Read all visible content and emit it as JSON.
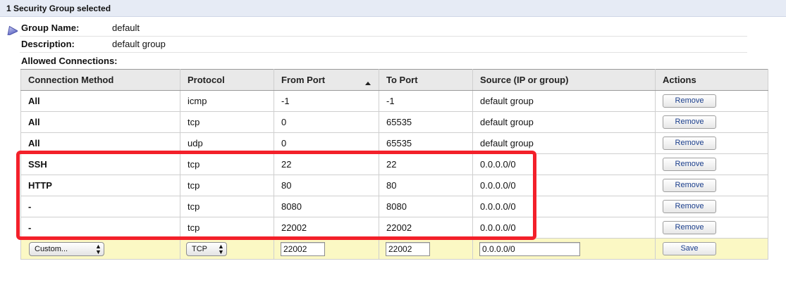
{
  "header": {
    "title": "1 Security Group selected"
  },
  "group": {
    "name_label": "Group Name:",
    "name_value": "default",
    "description_label": "Description:",
    "description_value": "default group"
  },
  "allowed": {
    "label": "Allowed Connections:",
    "columns": [
      "Connection Method",
      "Protocol",
      "From Port",
      "To Port",
      "Source (IP or group)",
      "Actions"
    ],
    "sorted_column": "From Port",
    "sort_direction": "ascending",
    "rows": [
      {
        "method": "All",
        "protocol": "icmp",
        "from": "-1",
        "to": "-1",
        "source": "default group",
        "action": "Remove"
      },
      {
        "method": "All",
        "protocol": "tcp",
        "from": "0",
        "to": "65535",
        "source": "default group",
        "action": "Remove"
      },
      {
        "method": "All",
        "protocol": "udp",
        "from": "0",
        "to": "65535",
        "source": "default group",
        "action": "Remove"
      },
      {
        "method": "SSH",
        "protocol": "tcp",
        "from": "22",
        "to": "22",
        "source": "0.0.0.0/0",
        "action": "Remove"
      },
      {
        "method": "HTTP",
        "protocol": "tcp",
        "from": "80",
        "to": "80",
        "source": "0.0.0.0/0",
        "action": "Remove"
      },
      {
        "method": "-",
        "protocol": "tcp",
        "from": "8080",
        "to": "8080",
        "source": "0.0.0.0/0",
        "action": "Remove"
      },
      {
        "method": "-",
        "protocol": "tcp",
        "from": "22002",
        "to": "22002",
        "source": "0.0.0.0/0",
        "action": "Remove"
      }
    ],
    "new_rule": {
      "method": "Custom...",
      "protocol": "TCP",
      "from": "22002",
      "to": "22002",
      "source": "0.0.0.0/0",
      "save_label": "Save"
    }
  },
  "colors": {
    "highlight": "#f3202a",
    "add_row_bg": "#fbf8c4",
    "header_bar": "#e6ebf5",
    "button_text": "#1a3e8c"
  }
}
